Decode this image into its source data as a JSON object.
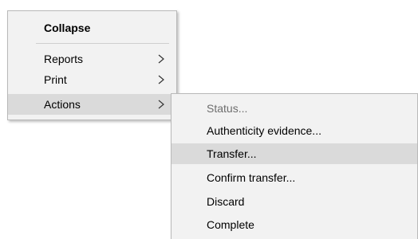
{
  "main_menu": {
    "collapse_label": "Collapse",
    "items": [
      {
        "label": "Reports",
        "icon": "chevron-right-icon"
      },
      {
        "label": "Print",
        "icon": "chevron-right-icon"
      },
      {
        "label": "Actions",
        "icon": "chevron-right-icon"
      }
    ]
  },
  "actions_submenu": {
    "items": [
      {
        "label": "Status...",
        "state": "disabled"
      },
      {
        "label": "Authenticity evidence..."
      },
      {
        "label": "Transfer...",
        "state": "highlighted"
      },
      {
        "label": "Confirm transfer..."
      },
      {
        "label": "Discard"
      },
      {
        "label": "Complete"
      }
    ]
  },
  "colors": {
    "menu_background": "#f2f2f2",
    "highlight": "#dadada",
    "disabled_text": "#6d6d6d",
    "border": "#b9b9b9"
  }
}
